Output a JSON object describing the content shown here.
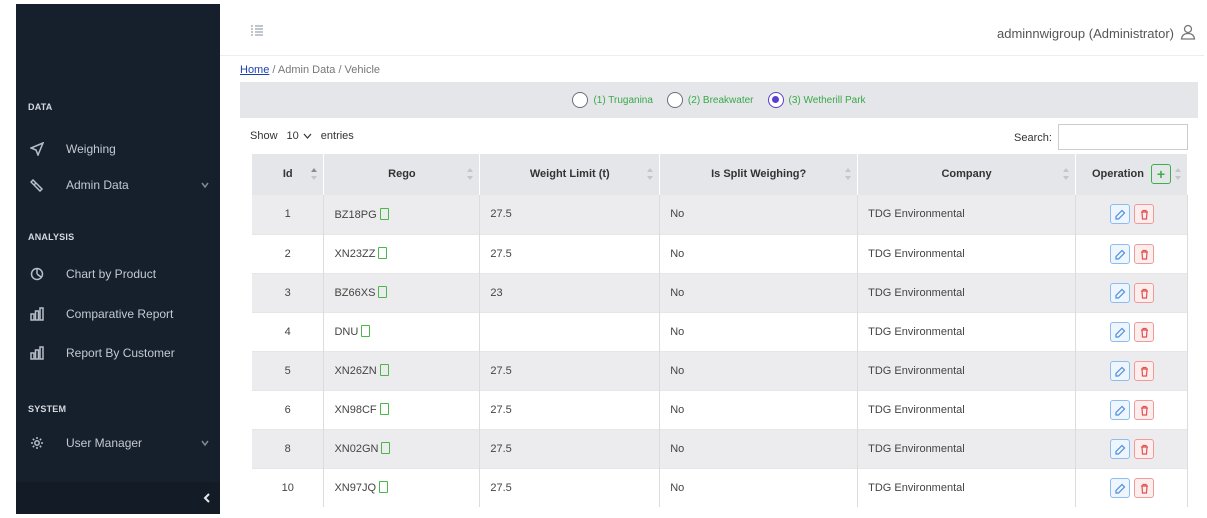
{
  "sidebar": {
    "sections": [
      {
        "title": "DATA",
        "items": [
          {
            "label": "Weighing",
            "icon": "send-icon"
          },
          {
            "label": "Admin Data",
            "icon": "settings-icon",
            "has_submenu": true
          }
        ]
      },
      {
        "title": "ANALYSIS",
        "items": [
          {
            "label": "Chart by Product",
            "icon": "pie-chart-icon"
          },
          {
            "label": "Comparative Report",
            "icon": "bar-chart-icon"
          },
          {
            "label": "Report By Customer",
            "icon": "bar-chart-icon"
          }
        ]
      },
      {
        "title": "SYSTEM",
        "items": [
          {
            "label": "User Manager",
            "icon": "gear-icon",
            "has_submenu": true
          }
        ]
      }
    ],
    "collapse_icon": "chevron-left-icon"
  },
  "topbar": {
    "menu_icon": "menu-toggle-icon",
    "user": "adminnwigroup (Administrator)",
    "user_icon": "user-icon"
  },
  "breadcrumb": {
    "home": "Home",
    "rest": "/  Admin Data / Vehicle"
  },
  "sites": [
    {
      "label": "(1) Truganina",
      "checked": false
    },
    {
      "label": "(2) Breakwater",
      "checked": false
    },
    {
      "label": "(3) Wetherill Park",
      "checked": true
    }
  ],
  "table_controls": {
    "show_label": "Show",
    "page_size": "10",
    "entries_label": "entries",
    "search_label": "Search:",
    "search_value": ""
  },
  "table": {
    "columns": [
      "Id",
      "Rego",
      "Weight Limit (t)",
      "Is Split Weighing?",
      "Company",
      "Operation"
    ],
    "rows": [
      {
        "id": "1",
        "rego": "BZ18PG",
        "weight": "27.5",
        "split": "No",
        "company": "TDG Environmental"
      },
      {
        "id": "2",
        "rego": "XN23ZZ",
        "weight": "27.5",
        "split": "No",
        "company": "TDG Environmental"
      },
      {
        "id": "3",
        "rego": "BZ66XS",
        "weight": "23",
        "split": "No",
        "company": "TDG Environmental"
      },
      {
        "id": "4",
        "rego": "DNU",
        "weight": "",
        "split": "No",
        "company": "TDG Environmental"
      },
      {
        "id": "5",
        "rego": "XN26ZN",
        "weight": "27.5",
        "split": "No",
        "company": "TDG Environmental"
      },
      {
        "id": "6",
        "rego": "XN98CF",
        "weight": "27.5",
        "split": "No",
        "company": "TDG Environmental"
      },
      {
        "id": "8",
        "rego": "XN02GN",
        "weight": "27.5",
        "split": "No",
        "company": "TDG Environmental"
      },
      {
        "id": "10",
        "rego": "XN97JQ",
        "weight": "27.5",
        "split": "No",
        "company": "TDG Environmental"
      }
    ]
  },
  "colors": {
    "sidebar_bg": "#16202d",
    "accent_green": "#3aa84a",
    "radio_selected": "#5a3fd0",
    "link_blue": "#1e3fb3"
  }
}
